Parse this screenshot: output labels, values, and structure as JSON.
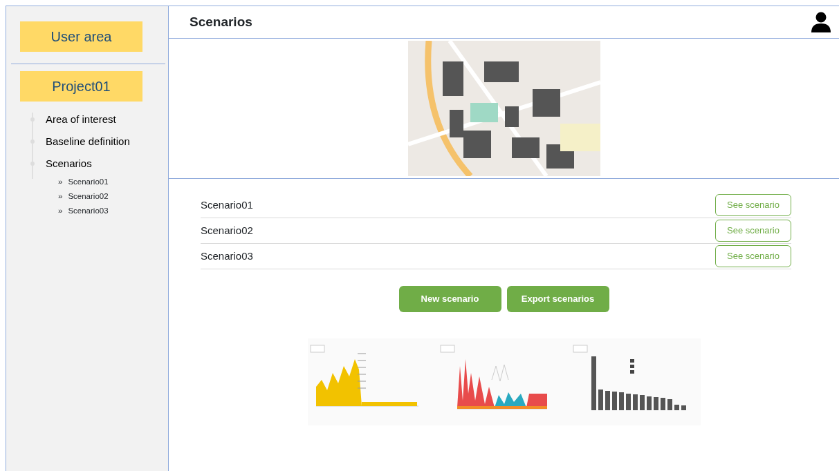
{
  "sidebar": {
    "user_area": "User area",
    "project": "Project01",
    "items": [
      {
        "label": "Area of interest"
      },
      {
        "label": "Baseline definition"
      },
      {
        "label": "Scenarios",
        "children": [
          {
            "marker": "»",
            "label": "Scenario01"
          },
          {
            "marker": "»",
            "label": "Scenario02"
          },
          {
            "marker": "»",
            "label": "Scenario03"
          }
        ]
      }
    ]
  },
  "header": {
    "title": "Scenarios"
  },
  "scenarios": [
    {
      "name": "Scenario01",
      "action": "See scenario"
    },
    {
      "name": "Scenario02",
      "action": "See scenario"
    },
    {
      "name": "Scenario03",
      "action": "See scenario"
    }
  ],
  "buttons": [
    "New scenario",
    "Export scenarios"
  ]
}
